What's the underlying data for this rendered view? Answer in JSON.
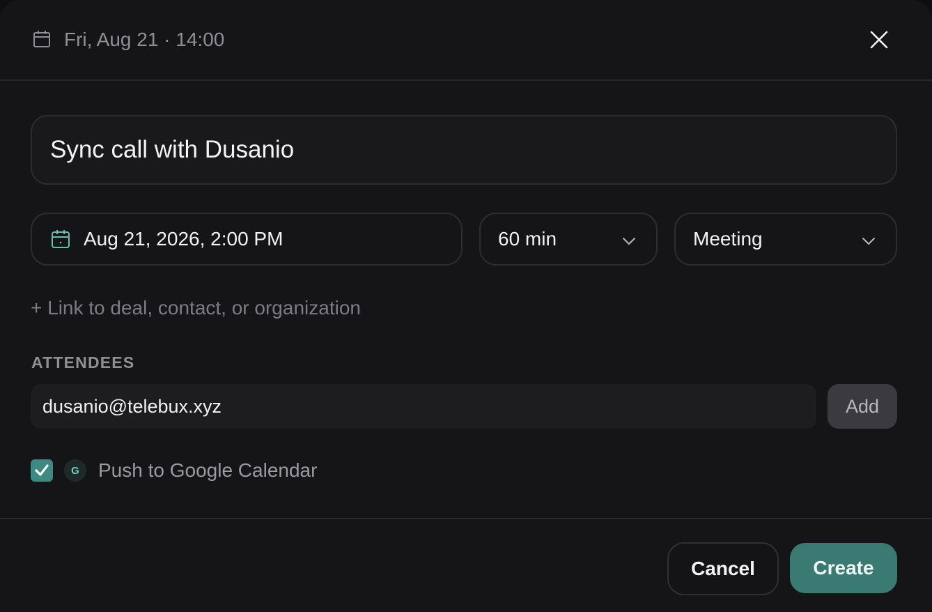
{
  "header": {
    "date_time": "Fri, Aug 21 · 14:00",
    "icon": "calendar-icon",
    "close_icon": "close-icon"
  },
  "form": {
    "title_value": "Sync call with Dusanio",
    "date_value": "Aug 21, 2026, 2:00 PM",
    "duration_value": "60 min",
    "type_value": "Meeting",
    "link_text": "+ Link to deal, contact, or organization",
    "attendees": {
      "label": "ATTENDEES",
      "input_value": "dusanio@telebux.xyz",
      "add_label": "Add"
    },
    "google_calendar": {
      "checked": true,
      "badge_letter": "G",
      "label": "Push to Google Calendar"
    }
  },
  "footer": {
    "cancel_label": "Cancel",
    "create_label": "Create"
  },
  "colors": {
    "accent": "#3a7a72",
    "checkbox": "#3e8a82",
    "background": "#151517"
  }
}
